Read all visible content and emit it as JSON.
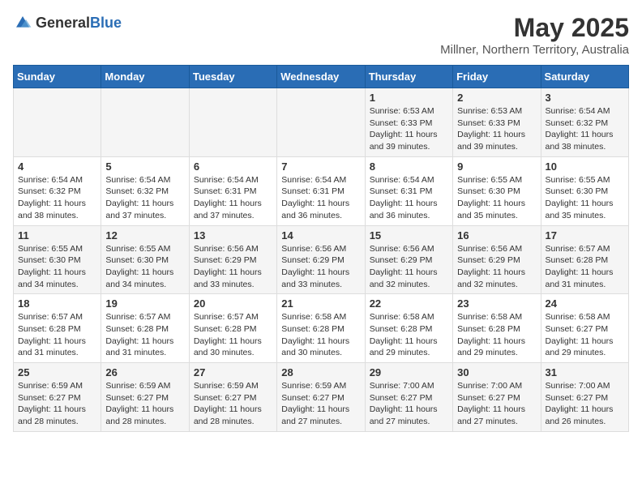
{
  "header": {
    "logo_general": "General",
    "logo_blue": "Blue",
    "title": "May 2025",
    "subtitle": "Millner, Northern Territory, Australia"
  },
  "days_of_week": [
    "Sunday",
    "Monday",
    "Tuesday",
    "Wednesday",
    "Thursday",
    "Friday",
    "Saturday"
  ],
  "weeks": [
    [
      {
        "day": "",
        "info": ""
      },
      {
        "day": "",
        "info": ""
      },
      {
        "day": "",
        "info": ""
      },
      {
        "day": "",
        "info": ""
      },
      {
        "day": "1",
        "info": "Sunrise: 6:53 AM\nSunset: 6:33 PM\nDaylight: 11 hours and 39 minutes."
      },
      {
        "day": "2",
        "info": "Sunrise: 6:53 AM\nSunset: 6:33 PM\nDaylight: 11 hours and 39 minutes."
      },
      {
        "day": "3",
        "info": "Sunrise: 6:54 AM\nSunset: 6:32 PM\nDaylight: 11 hours and 38 minutes."
      }
    ],
    [
      {
        "day": "4",
        "info": "Sunrise: 6:54 AM\nSunset: 6:32 PM\nDaylight: 11 hours and 38 minutes."
      },
      {
        "day": "5",
        "info": "Sunrise: 6:54 AM\nSunset: 6:32 PM\nDaylight: 11 hours and 37 minutes."
      },
      {
        "day": "6",
        "info": "Sunrise: 6:54 AM\nSunset: 6:31 PM\nDaylight: 11 hours and 37 minutes."
      },
      {
        "day": "7",
        "info": "Sunrise: 6:54 AM\nSunset: 6:31 PM\nDaylight: 11 hours and 36 minutes."
      },
      {
        "day": "8",
        "info": "Sunrise: 6:54 AM\nSunset: 6:31 PM\nDaylight: 11 hours and 36 minutes."
      },
      {
        "day": "9",
        "info": "Sunrise: 6:55 AM\nSunset: 6:30 PM\nDaylight: 11 hours and 35 minutes."
      },
      {
        "day": "10",
        "info": "Sunrise: 6:55 AM\nSunset: 6:30 PM\nDaylight: 11 hours and 35 minutes."
      }
    ],
    [
      {
        "day": "11",
        "info": "Sunrise: 6:55 AM\nSunset: 6:30 PM\nDaylight: 11 hours and 34 minutes."
      },
      {
        "day": "12",
        "info": "Sunrise: 6:55 AM\nSunset: 6:30 PM\nDaylight: 11 hours and 34 minutes."
      },
      {
        "day": "13",
        "info": "Sunrise: 6:56 AM\nSunset: 6:29 PM\nDaylight: 11 hours and 33 minutes."
      },
      {
        "day": "14",
        "info": "Sunrise: 6:56 AM\nSunset: 6:29 PM\nDaylight: 11 hours and 33 minutes."
      },
      {
        "day": "15",
        "info": "Sunrise: 6:56 AM\nSunset: 6:29 PM\nDaylight: 11 hours and 32 minutes."
      },
      {
        "day": "16",
        "info": "Sunrise: 6:56 AM\nSunset: 6:29 PM\nDaylight: 11 hours and 32 minutes."
      },
      {
        "day": "17",
        "info": "Sunrise: 6:57 AM\nSunset: 6:28 PM\nDaylight: 11 hours and 31 minutes."
      }
    ],
    [
      {
        "day": "18",
        "info": "Sunrise: 6:57 AM\nSunset: 6:28 PM\nDaylight: 11 hours and 31 minutes."
      },
      {
        "day": "19",
        "info": "Sunrise: 6:57 AM\nSunset: 6:28 PM\nDaylight: 11 hours and 31 minutes."
      },
      {
        "day": "20",
        "info": "Sunrise: 6:57 AM\nSunset: 6:28 PM\nDaylight: 11 hours and 30 minutes."
      },
      {
        "day": "21",
        "info": "Sunrise: 6:58 AM\nSunset: 6:28 PM\nDaylight: 11 hours and 30 minutes."
      },
      {
        "day": "22",
        "info": "Sunrise: 6:58 AM\nSunset: 6:28 PM\nDaylight: 11 hours and 29 minutes."
      },
      {
        "day": "23",
        "info": "Sunrise: 6:58 AM\nSunset: 6:28 PM\nDaylight: 11 hours and 29 minutes."
      },
      {
        "day": "24",
        "info": "Sunrise: 6:58 AM\nSunset: 6:27 PM\nDaylight: 11 hours and 29 minutes."
      }
    ],
    [
      {
        "day": "25",
        "info": "Sunrise: 6:59 AM\nSunset: 6:27 PM\nDaylight: 11 hours and 28 minutes."
      },
      {
        "day": "26",
        "info": "Sunrise: 6:59 AM\nSunset: 6:27 PM\nDaylight: 11 hours and 28 minutes."
      },
      {
        "day": "27",
        "info": "Sunrise: 6:59 AM\nSunset: 6:27 PM\nDaylight: 11 hours and 28 minutes."
      },
      {
        "day": "28",
        "info": "Sunrise: 6:59 AM\nSunset: 6:27 PM\nDaylight: 11 hours and 27 minutes."
      },
      {
        "day": "29",
        "info": "Sunrise: 7:00 AM\nSunset: 6:27 PM\nDaylight: 11 hours and 27 minutes."
      },
      {
        "day": "30",
        "info": "Sunrise: 7:00 AM\nSunset: 6:27 PM\nDaylight: 11 hours and 27 minutes."
      },
      {
        "day": "31",
        "info": "Sunrise: 7:00 AM\nSunset: 6:27 PM\nDaylight: 11 hours and 26 minutes."
      }
    ]
  ]
}
